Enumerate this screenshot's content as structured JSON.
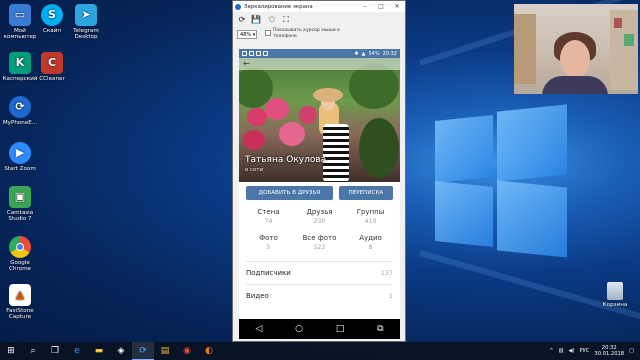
{
  "desktop": {
    "icons": [
      {
        "label": "Мой компьютер",
        "color": "#3a7bd5"
      },
      {
        "label": "Скайп",
        "color": "#00aff0"
      },
      {
        "label": "Telegram Desktop",
        "color": "#2ca5e0"
      },
      {
        "label": "Касперский",
        "color": "#009e7b"
      },
      {
        "label": "CCleaner",
        "color": "#c0392b"
      },
      {
        "label": "MyPhoneE...",
        "color": "#1e6ad1"
      },
      {
        "label": "Start Zoom",
        "color": "#2d8cff"
      },
      {
        "label": "Camtasia Studio 7",
        "color": "#3aa655"
      },
      {
        "label": "Google Chrome",
        "color": "#e74c3c"
      },
      {
        "label": "FastStone Capture",
        "color": "#d35400"
      }
    ],
    "recycle_bin": "Корзина"
  },
  "window": {
    "title": "Зеркалирование экрана",
    "zoom": "48%",
    "show_cursor_label": "Показывать курсор мыши в телефоне"
  },
  "phone": {
    "status": {
      "battery": "54%",
      "time": "20:32"
    },
    "profile": {
      "name": "Татьяна Окулова",
      "status": "в сети"
    },
    "actions": {
      "add_friend": "ДОБАВИТЬ В ДРУЗЬЯ",
      "message": "ПЕРЕПИСКА"
    },
    "stats": [
      {
        "label": "Стена",
        "value": "74"
      },
      {
        "label": "Друзья",
        "value": "230"
      },
      {
        "label": "Группы",
        "value": "410"
      },
      {
        "label": "Фото",
        "value": "5"
      },
      {
        "label": "Все фото",
        "value": "522"
      },
      {
        "label": "Аудио",
        "value": "8"
      }
    ],
    "rows": [
      {
        "label": "Подписчики",
        "value": "137"
      },
      {
        "label": "Видео",
        "value": "1"
      }
    ]
  },
  "taskbar": {
    "lang": "РУС",
    "time": "20:32",
    "date": "30.01.2018"
  }
}
